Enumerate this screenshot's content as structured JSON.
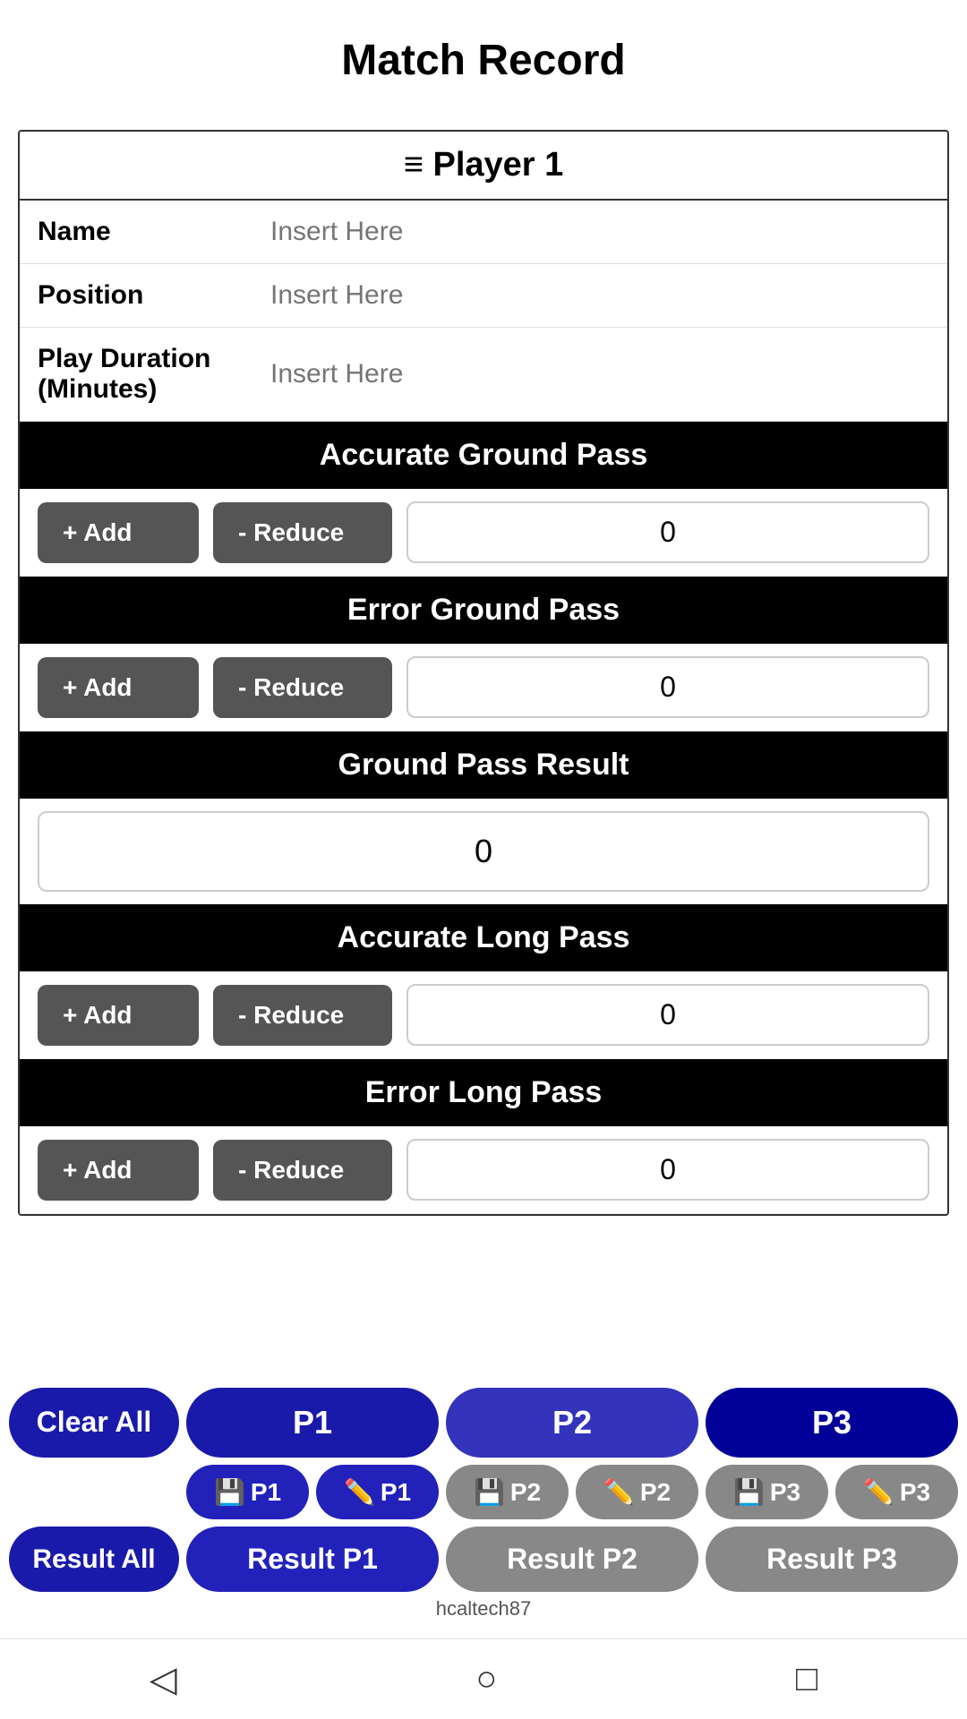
{
  "page": {
    "title": "Match Record"
  },
  "player_card": {
    "header": "Player 1",
    "header_icon": "≡",
    "fields": {
      "name_label": "Name",
      "name_placeholder": "Insert Here",
      "position_label": "Position",
      "position_placeholder": "Insert Here",
      "play_duration_label": "Play Duration (Minutes)",
      "play_duration_placeholder": "Insert Here"
    }
  },
  "sections": {
    "accurate_ground_pass": {
      "label": "Accurate Ground Pass",
      "add_label": "+ Add",
      "reduce_label": "- Reduce",
      "value": "0"
    },
    "error_ground_pass": {
      "label": "Error Ground Pass",
      "add_label": "+ Add",
      "reduce_label": "- Reduce",
      "value": "0"
    },
    "ground_pass_result": {
      "label": "Ground Pass Result",
      "value": "0"
    },
    "accurate_long_pass": {
      "label": "Accurate Long Pass",
      "add_label": "+ Add",
      "reduce_label": "- Reduce",
      "value": "0"
    },
    "error_long_pass": {
      "label": "Error Long Pass",
      "add_label": "+ Add",
      "reduce_label": "- Reduce",
      "value": "0"
    }
  },
  "bottom_nav": {
    "clear_all": "Clear All",
    "p1": "P1",
    "p2": "P2",
    "p3": "P3",
    "save_p1": "P1",
    "edit_p1": "P1",
    "save_p2": "P2",
    "edit_p2": "P2",
    "save_p3": "P3",
    "edit_p3": "P3",
    "result_all": "Result All",
    "result_p1": "Result P1",
    "result_p2": "Result P2",
    "result_p3": "Result P3"
  },
  "watermark": "hcaltech87",
  "android_nav": {
    "back": "◁",
    "home": "○",
    "recents": "□"
  }
}
